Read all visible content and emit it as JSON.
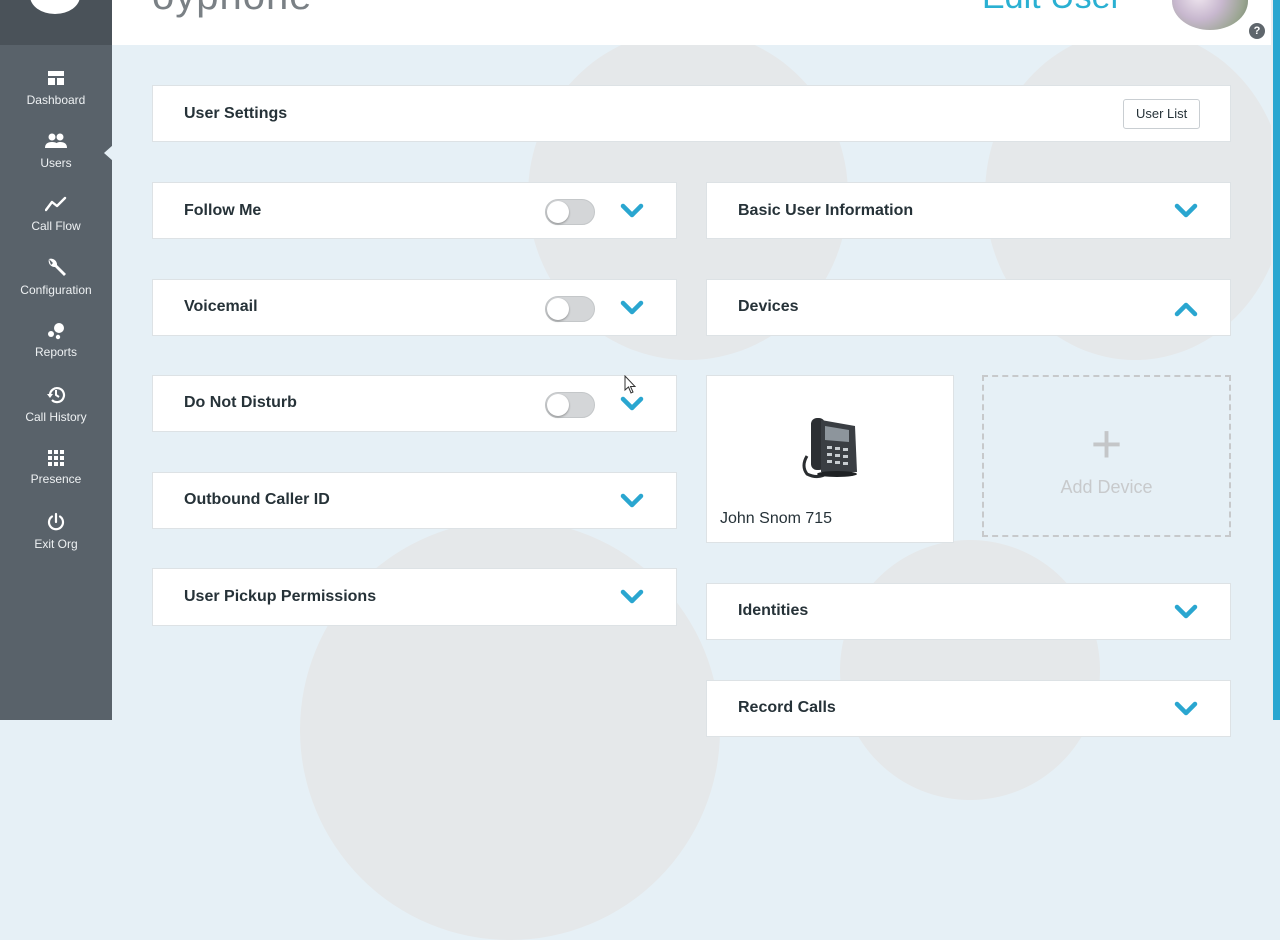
{
  "header": {
    "brand": "oyphone",
    "page_heading": "Edit User",
    "help_symbol": "?"
  },
  "sidebar": {
    "items": [
      {
        "label": "Dashboard",
        "icon": "dashboard-icon"
      },
      {
        "label": "Users",
        "icon": "users-icon"
      },
      {
        "label": "Call Flow",
        "icon": "call-flow-icon"
      },
      {
        "label": "Configuration",
        "icon": "wrench-icon"
      },
      {
        "label": "Reports",
        "icon": "reports-icon"
      },
      {
        "label": "Call History",
        "icon": "history-icon"
      },
      {
        "label": "Presence",
        "icon": "grid-icon"
      },
      {
        "label": "Exit Org",
        "icon": "power-icon"
      }
    ],
    "active": "Users"
  },
  "user_settings": {
    "title": "User Settings",
    "user_list_button": "User List"
  },
  "left_sections": [
    {
      "title": "Follow Me",
      "toggle": false
    },
    {
      "title": "Voicemail",
      "toggle": false
    },
    {
      "title": "Do Not Disturb",
      "toggle": false
    },
    {
      "title": "Outbound Caller ID"
    },
    {
      "title": "User Pickup Permissions"
    }
  ],
  "right_sections": {
    "basic_info": "Basic User Information",
    "devices": "Devices",
    "identities": "Identities",
    "record_calls": "Record Calls"
  },
  "devices": {
    "items": [
      {
        "name": "John Snom 715"
      }
    ],
    "add_label": "Add Device",
    "add_symbol": "+"
  },
  "colors": {
    "sidebar": "#59626a",
    "accent": "#2aa6d0",
    "background": "#e6f0f6"
  }
}
